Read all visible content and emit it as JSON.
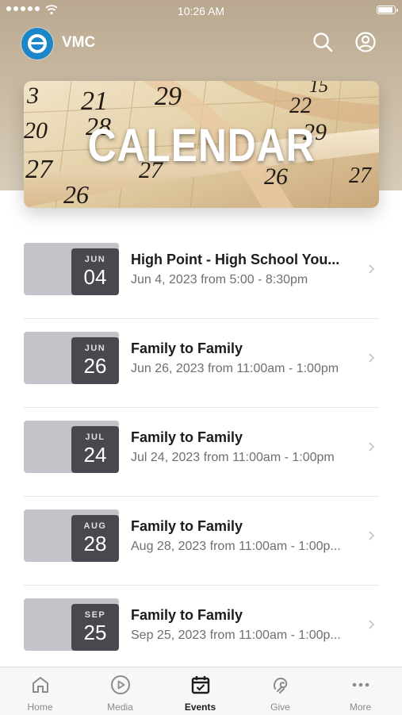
{
  "status_bar": {
    "time": "10:26 AM"
  },
  "header": {
    "app_name": "VMC",
    "logo_icon": "church-logo-icon",
    "search_icon": "search-icon",
    "profile_icon": "profile-icon"
  },
  "banner": {
    "title": "CALENDAR",
    "calendar_numbers": [
      "3",
      "21",
      "29",
      "15",
      "28",
      "22",
      "20",
      "29",
      "27",
      "27",
      "26",
      "26",
      "27"
    ]
  },
  "events": [
    {
      "month": "JUN",
      "day": "04",
      "title": "High Point - High School You...",
      "when": "Jun 4, 2023 from 5:00 - 8:30pm"
    },
    {
      "month": "JUN",
      "day": "26",
      "title": "Family to Family",
      "when": "Jun 26, 2023 from 11:00am - 1:00pm"
    },
    {
      "month": "JUL",
      "day": "24",
      "title": "Family to Family",
      "when": "Jul 24, 2023 from 11:00am - 1:00pm"
    },
    {
      "month": "AUG",
      "day": "28",
      "title": "Family to Family",
      "when": "Aug 28, 2023 from 11:00am - 1:00p..."
    },
    {
      "month": "SEP",
      "day": "25",
      "title": "Family to Family",
      "when": "Sep 25, 2023 from 11:00am - 1:00p..."
    }
  ],
  "tabs": [
    {
      "label": "Home",
      "icon": "home-icon",
      "active": false
    },
    {
      "label": "Media",
      "icon": "play-icon",
      "active": false
    },
    {
      "label": "Events",
      "icon": "calendar-icon",
      "active": true
    },
    {
      "label": "Give",
      "icon": "give-icon",
      "active": false
    },
    {
      "label": "More",
      "icon": "more-icon",
      "active": false
    }
  ],
  "colors": {
    "accent": "#1b86c8",
    "date_box": "#47494e",
    "thumb": "#c2c4c9"
  }
}
